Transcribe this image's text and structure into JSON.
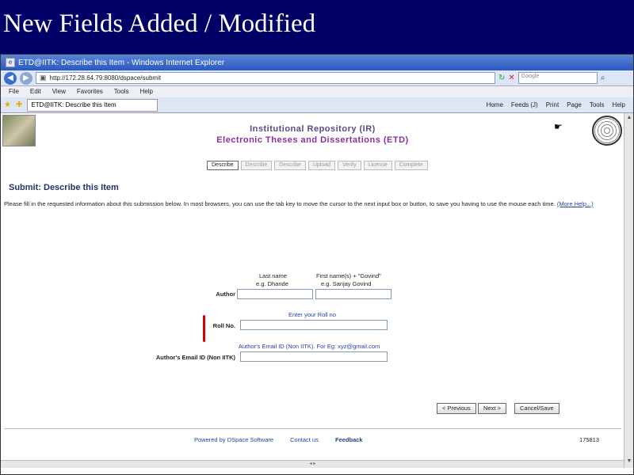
{
  "slide": {
    "title": "New Fields Added / Modified"
  },
  "browser": {
    "window_title": "ETD@IITK: Describe this Item - Windows Internet Explorer",
    "url": "http://172.28.64.79:8080/dspace/submit",
    "search_placeholder": "Google",
    "menu": [
      "File",
      "Edit",
      "View",
      "Favorites",
      "Tools",
      "Help"
    ],
    "tab_title": "ETD@IITK: Describe this Item",
    "commands": [
      "Home",
      "Feeds (J)",
      "Print",
      "Page",
      "Tools",
      "Help"
    ]
  },
  "page": {
    "repo_title_1": "Institutional Repository (IR)",
    "repo_title_2": "Electronic Theses and Dissertations (ETD)",
    "steps": [
      "Describe",
      "Describe",
      "Describe",
      "Upload",
      "Verify",
      "License",
      "Complete"
    ],
    "heading": "Submit: Describe this Item",
    "instructions": "Please fill in the requested information about this submission below. In most browsers, you can use the tab key to move the cursor to the next input box or button, to save you having to use the mouse each time.",
    "more_help": "(More Help...)",
    "author": {
      "last_name_label": "Last name",
      "last_name_example": "e.g. Dhande",
      "first_name_label": "First name(s) + \"Govind\"",
      "first_name_example": "e.g. Sanjay Govind",
      "label": "Author"
    },
    "roll": {
      "hint": "Enter your Roll no",
      "label": "Roll No."
    },
    "email": {
      "hint": "Author's Email ID (Non IITK). For Eg: xyz@gmail.com",
      "label": "Author's Email ID (Non IITK)"
    },
    "buttons": {
      "previous": "< Previous",
      "next": "Next >",
      "cancel": "Cancel/Save"
    },
    "footer": {
      "powered": "Powered by DSpace Software",
      "contact": "Contact us",
      "feedback": "Feedback",
      "count": "175813"
    }
  }
}
